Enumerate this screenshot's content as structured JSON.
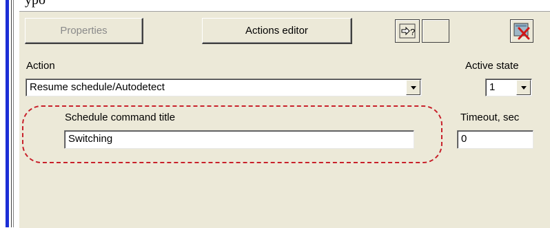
{
  "header": {
    "cut_text": "ypo"
  },
  "toolbar": {
    "properties_label": "Properties",
    "actions_editor_label": "Actions editor",
    "help_icon": "help-arrow-icon",
    "blank_icon": "blank-icon",
    "close_icon": "red-x-close-icon"
  },
  "action": {
    "label": "Action",
    "value": "Resume schedule/Autodetect"
  },
  "active_state": {
    "label": "Active state",
    "value": "1"
  },
  "schedule_command": {
    "label": "Schedule command title",
    "value": "Switching"
  },
  "timeout": {
    "label": "Timeout, sec",
    "value": "0"
  },
  "colors": {
    "panel_bg": "#ece9d8",
    "highlight_dash": "#c8202a",
    "window_accent": "#1c2fd6"
  }
}
